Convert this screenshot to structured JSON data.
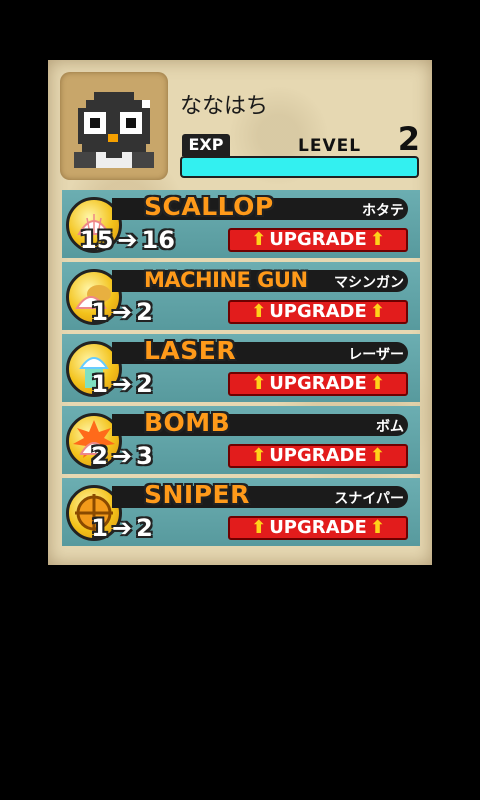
{
  "player": {
    "name": "ななはち",
    "exp_label": "EXP",
    "level_label": "LEVEL",
    "level": "2",
    "exp_fraction": 1.0
  },
  "weapons": [
    {
      "name": "SCALLOP",
      "jp": "ホタテ",
      "from": "15",
      "to": "16",
      "upgrade": "UPGRADE",
      "icon": "scallop-icon"
    },
    {
      "name": "MACHINE GUN",
      "jp": "マシンガン",
      "from": "1",
      "to": "2",
      "upgrade": "UPGRADE",
      "icon": "machine-gun-icon"
    },
    {
      "name": "LASER",
      "jp": "レーザー",
      "from": "1",
      "to": "2",
      "upgrade": "UPGRADE",
      "icon": "laser-icon"
    },
    {
      "name": "BOMB",
      "jp": "ボム",
      "from": "2",
      "to": "3",
      "upgrade": "UPGRADE",
      "icon": "bomb-icon"
    },
    {
      "name": "SNIPER",
      "jp": "スナイパー",
      "from": "1",
      "to": "2",
      "upgrade": "UPGRADE",
      "icon": "sniper-icon"
    }
  ],
  "glyphs": {
    "arrow": "➔",
    "up": "⬆"
  },
  "colors": {
    "exp_fill": "#33f0f0",
    "upgrade_button": "#e21c1c",
    "weapon_name": "#ff9a1a",
    "row_bg": "#5fa7ab"
  }
}
